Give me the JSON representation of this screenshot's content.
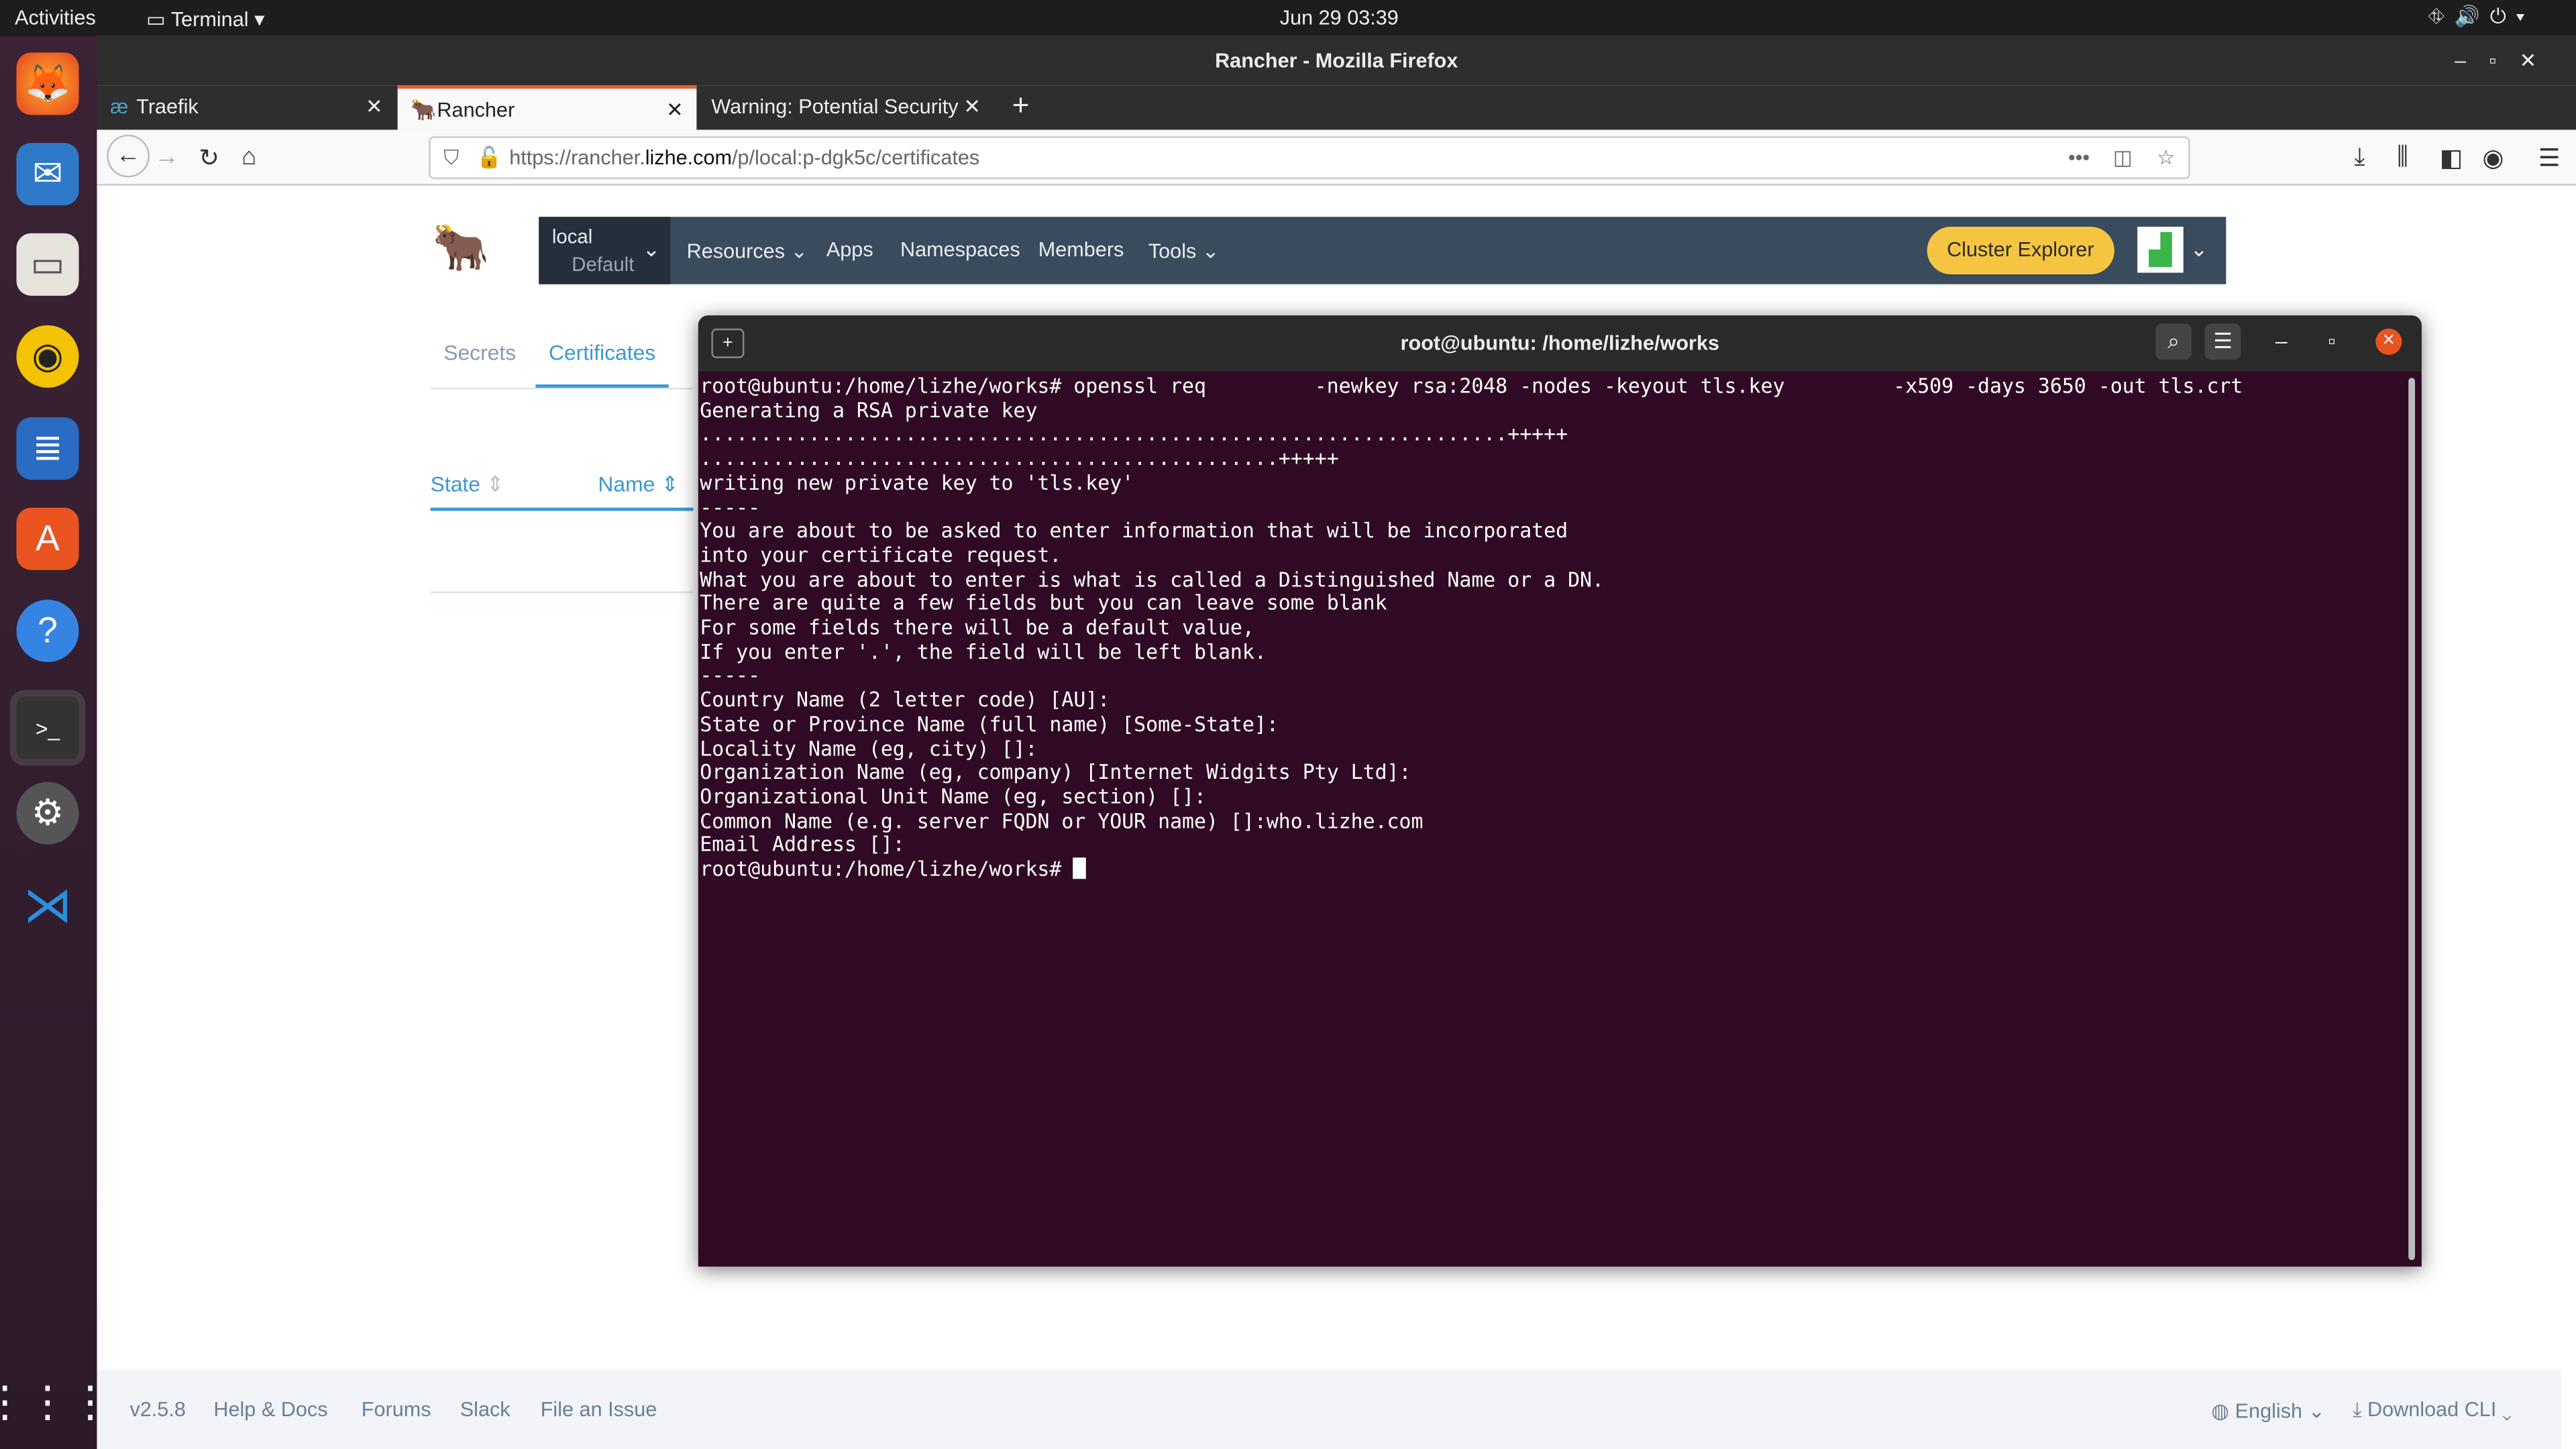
{
  "topbar": {
    "activities": "Activities",
    "app": "Terminal",
    "clock": "Jun 29  03:39"
  },
  "dock": [
    "firefox",
    "thunderbird",
    "files",
    "rhythmbox",
    "writer",
    "software",
    "help",
    "terminal",
    "settings",
    "vscode",
    "apps-grid"
  ],
  "firefox": {
    "title": "Rancher - Mozilla Firefox",
    "tabs": [
      {
        "label": "Traefik",
        "active": false
      },
      {
        "label": "Rancher",
        "active": true
      },
      {
        "label": "Warning: Potential Security",
        "active": false
      }
    ],
    "url_prefix": "https://rancher.",
    "url_domain": "lizhe.com",
    "url_suffix": "/p/local:p-dgk5c/certificates"
  },
  "rancher": {
    "cluster": "local",
    "project": "Default",
    "nav": [
      "Resources",
      "Apps",
      "Namespaces",
      "Members",
      "Tools"
    ],
    "cluster_explorer": "Cluster Explorer",
    "subtabs": [
      "Secrets",
      "Certificates"
    ],
    "columns": [
      "State",
      "Name"
    ],
    "accent": "#3d98d3",
    "footer": {
      "version": "v2.5.8",
      "links": [
        "Help & Docs",
        "Forums",
        "Slack",
        "File an Issue"
      ],
      "language": "English",
      "download": "Download CLI"
    }
  },
  "terminal": {
    "title": "root@ubuntu: /home/lizhe/works",
    "lines": [
      "root@ubuntu:/home/lizhe/works# openssl req         -newkey rsa:2048 -nodes -keyout tls.key         -x509 -days 3650 -out tls.crt",
      "Generating a RSA private key",
      "...................................................................+++++",
      "................................................+++++",
      "writing new private key to 'tls.key'",
      "-----",
      "You are about to be asked to enter information that will be incorporated",
      "into your certificate request.",
      "What you are about to enter is what is called a Distinguished Name or a DN.",
      "There are quite a few fields but you can leave some blank",
      "For some fields there will be a default value,",
      "If you enter '.', the field will be left blank.",
      "-----",
      "Country Name (2 letter code) [AU]:",
      "State or Province Name (full name) [Some-State]:",
      "Locality Name (eg, city) []:",
      "Organization Name (eg, company) [Internet Widgits Pty Ltd]:",
      "Organizational Unit Name (eg, section) []:",
      "Common Name (e.g. server FQDN or YOUR name) []:who.lizhe.com",
      "Email Address []:"
    ],
    "prompt": "root@ubuntu:/home/lizhe/works# "
  }
}
